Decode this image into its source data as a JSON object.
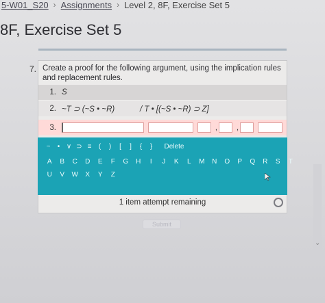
{
  "breadcrumb": {
    "course": "5-W01_S20",
    "sep1": "›",
    "assignments": "Assignments",
    "sep2": "›",
    "current": "Level 2, 8F, Exercise Set 5"
  },
  "page_title": "8F, Exercise Set 5",
  "question": {
    "number": "7.",
    "prompt": "Create a proof for the following argument, using the implication rules and replacement rules.",
    "steps": [
      {
        "num": "1.",
        "formula": "S",
        "justification": ""
      },
      {
        "num": "2.",
        "formula": "~T ⊃ (~S • ~R)",
        "justification": "/ T • [(~S • ~R) ⊃ Z]"
      },
      {
        "num": "3.",
        "formula": "",
        "justification": ""
      }
    ],
    "line_sep": ","
  },
  "keyboard": {
    "symbols": [
      "~",
      "•",
      "∨",
      "⊃",
      "≡",
      "(",
      ")",
      "[",
      "]",
      "{",
      "}"
    ],
    "delete_label": "Delete",
    "row1": [
      "A",
      "B",
      "C",
      "D",
      "E",
      "F",
      "G",
      "H",
      "I",
      "J",
      "K",
      "L",
      "M",
      "N",
      "O",
      "P",
      "Q",
      "R",
      "S",
      "T"
    ],
    "row2": [
      "U",
      "V",
      "W",
      "X",
      "Y",
      "Z"
    ]
  },
  "attempts_text": "1 item attempt remaining",
  "submit_label": "Submit",
  "colors": {
    "keyboard_bg": "#1ba3b5",
    "active_step_bg": "#ffdad8",
    "card_bg": "#ecebea"
  },
  "icons": {
    "scroll_down": "chevron-down-icon"
  }
}
